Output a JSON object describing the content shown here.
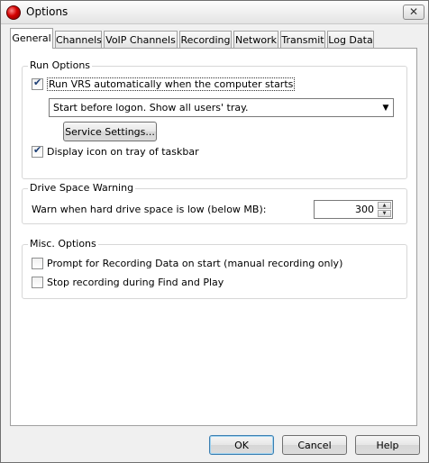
{
  "window": {
    "title": "Options",
    "close_glyph": "✕"
  },
  "tabs": [
    {
      "label": "General",
      "active": true
    },
    {
      "label": "Channels"
    },
    {
      "label": "VoIP Channels"
    },
    {
      "label": "Recording"
    },
    {
      "label": "Network"
    },
    {
      "label": "Transmit"
    },
    {
      "label": "Log Data"
    }
  ],
  "run_options": {
    "title": "Run Options",
    "auto_run_label": "Run VRS automatically when the computer starts",
    "auto_run_checked": true,
    "start_mode_value": "Start before logon. Show all users' tray.",
    "service_settings_label": "Service Settings...",
    "tray_icon_label": "Display icon on tray of taskbar",
    "tray_icon_checked": true
  },
  "drive_space": {
    "title": "Drive Space Warning",
    "warn_label": "Warn when hard drive space is low (below MB):",
    "warn_value": "300"
  },
  "misc": {
    "title": "Misc. Options",
    "prompt_label": "Prompt for Recording Data on start (manual recording only)",
    "prompt_checked": false,
    "stop_label": "Stop recording during Find and Play",
    "stop_checked": false
  },
  "buttons": {
    "ok": "OK",
    "cancel": "Cancel",
    "help": "Help"
  },
  "icons": {
    "app": "app-icon",
    "spin_up": "▲",
    "spin_down": "▼",
    "dropdown": "▼"
  }
}
